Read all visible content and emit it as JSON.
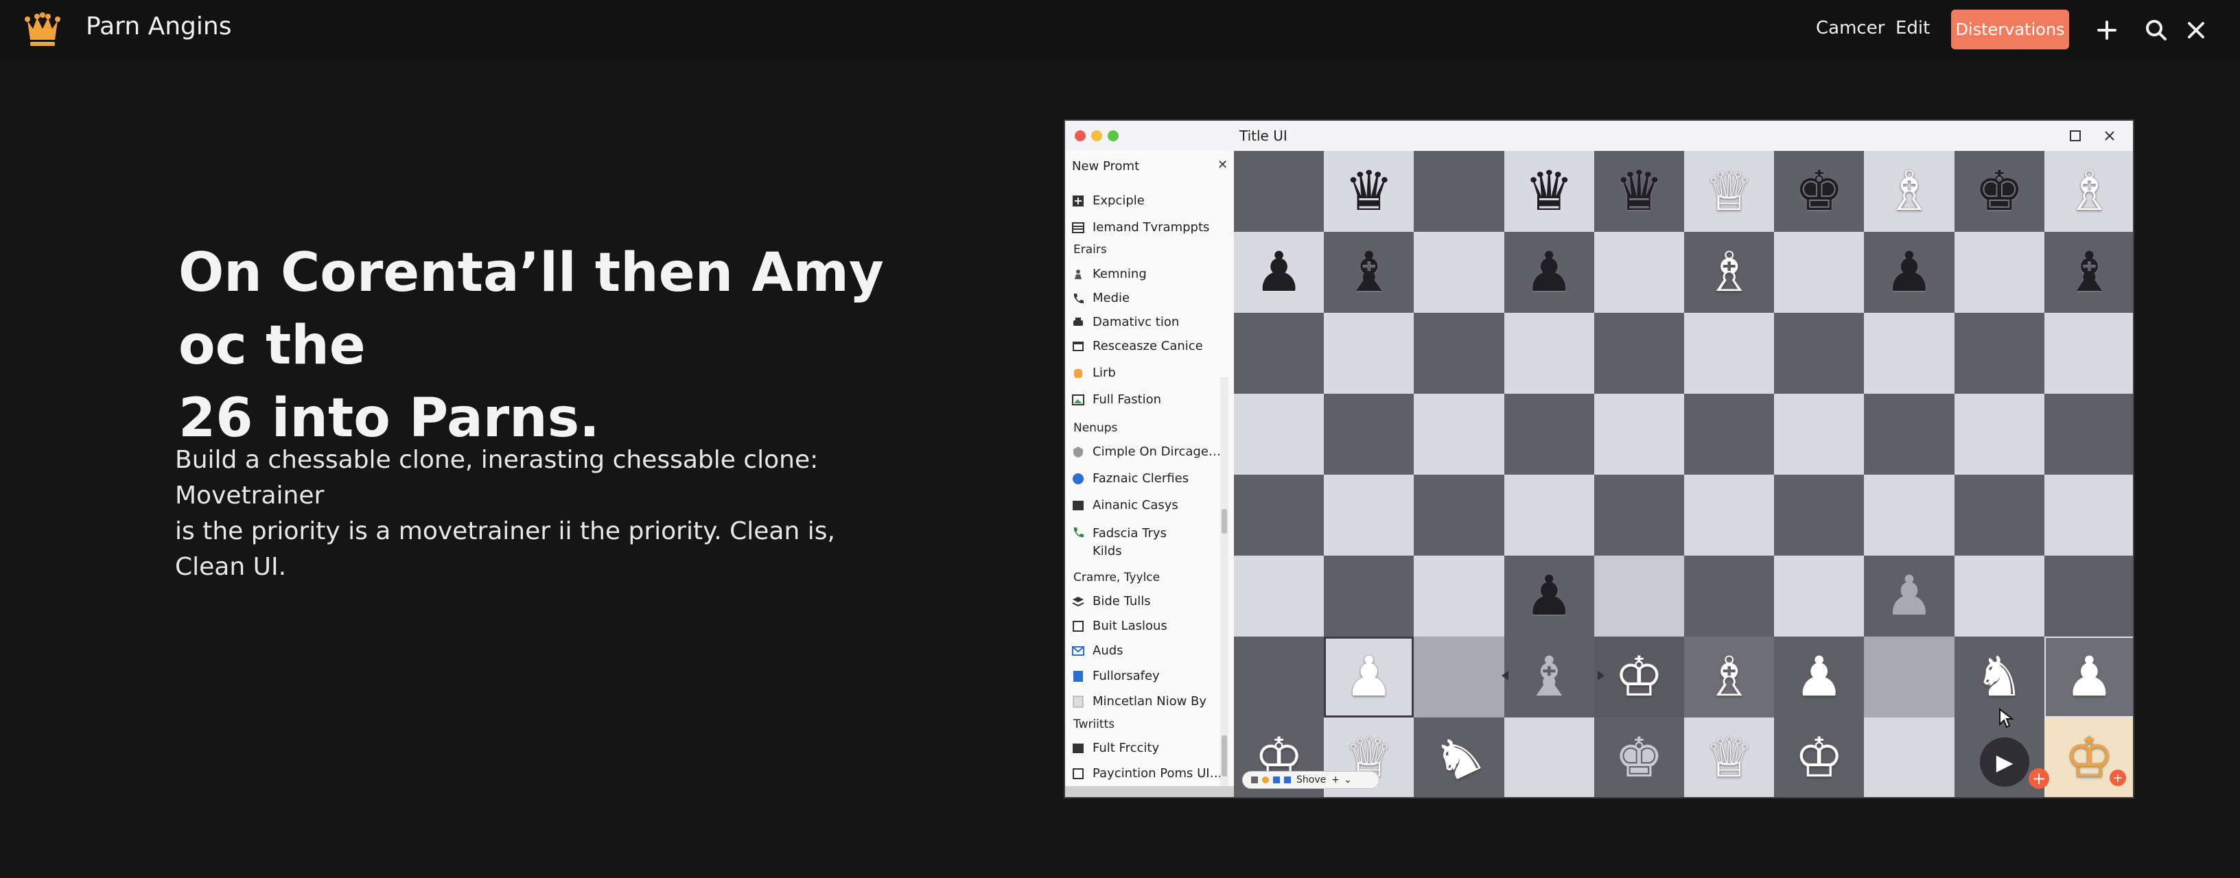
{
  "header": {
    "title": "Parn Angins",
    "links": [
      "Camcer",
      "Edit"
    ],
    "primary_button": "Distervations",
    "icons": [
      "plus-icon",
      "search-icon",
      "close-icon"
    ],
    "brand_color": "#f2a33a",
    "accent_color": "#f27b5e"
  },
  "hero": {
    "title_line1": "On Corenta’ll then Amy oc the",
    "title_line2": "26 into Parns.",
    "body_line1": "Build a chessable clone, inerasting chessable clone:  Movetrainer",
    "body_line2": "is the priority is a movetrainer ii the priority. Clean is, Clean UI."
  },
  "window": {
    "title": "Title UI",
    "panel_header": "New Promt",
    "sections": {
      "s1": "Erairs",
      "s2": "Nenups",
      "s3": "Cramre, Tyylce",
      "s4": "Twriitts"
    },
    "items": [
      "Expciple",
      "Iemand Tvramppts",
      "Kemning",
      "Medie",
      "Damativc tion",
      "Resceasze Canice",
      "Lirb",
      "Full Fastion",
      "Cimple On Dircage…",
      "Faznaic Clerfies",
      "Ainanic Casys",
      "Fadscia Trys",
      "Bide Tulls",
      "Buit Laslous",
      "Auds",
      "Fullorsafey",
      "Mincetlan Niow By",
      "Fult Frccity",
      "Paycintion Poms UI…"
    ],
    "item_wrap": "Kilds",
    "toolbar_label": "Shove"
  }
}
